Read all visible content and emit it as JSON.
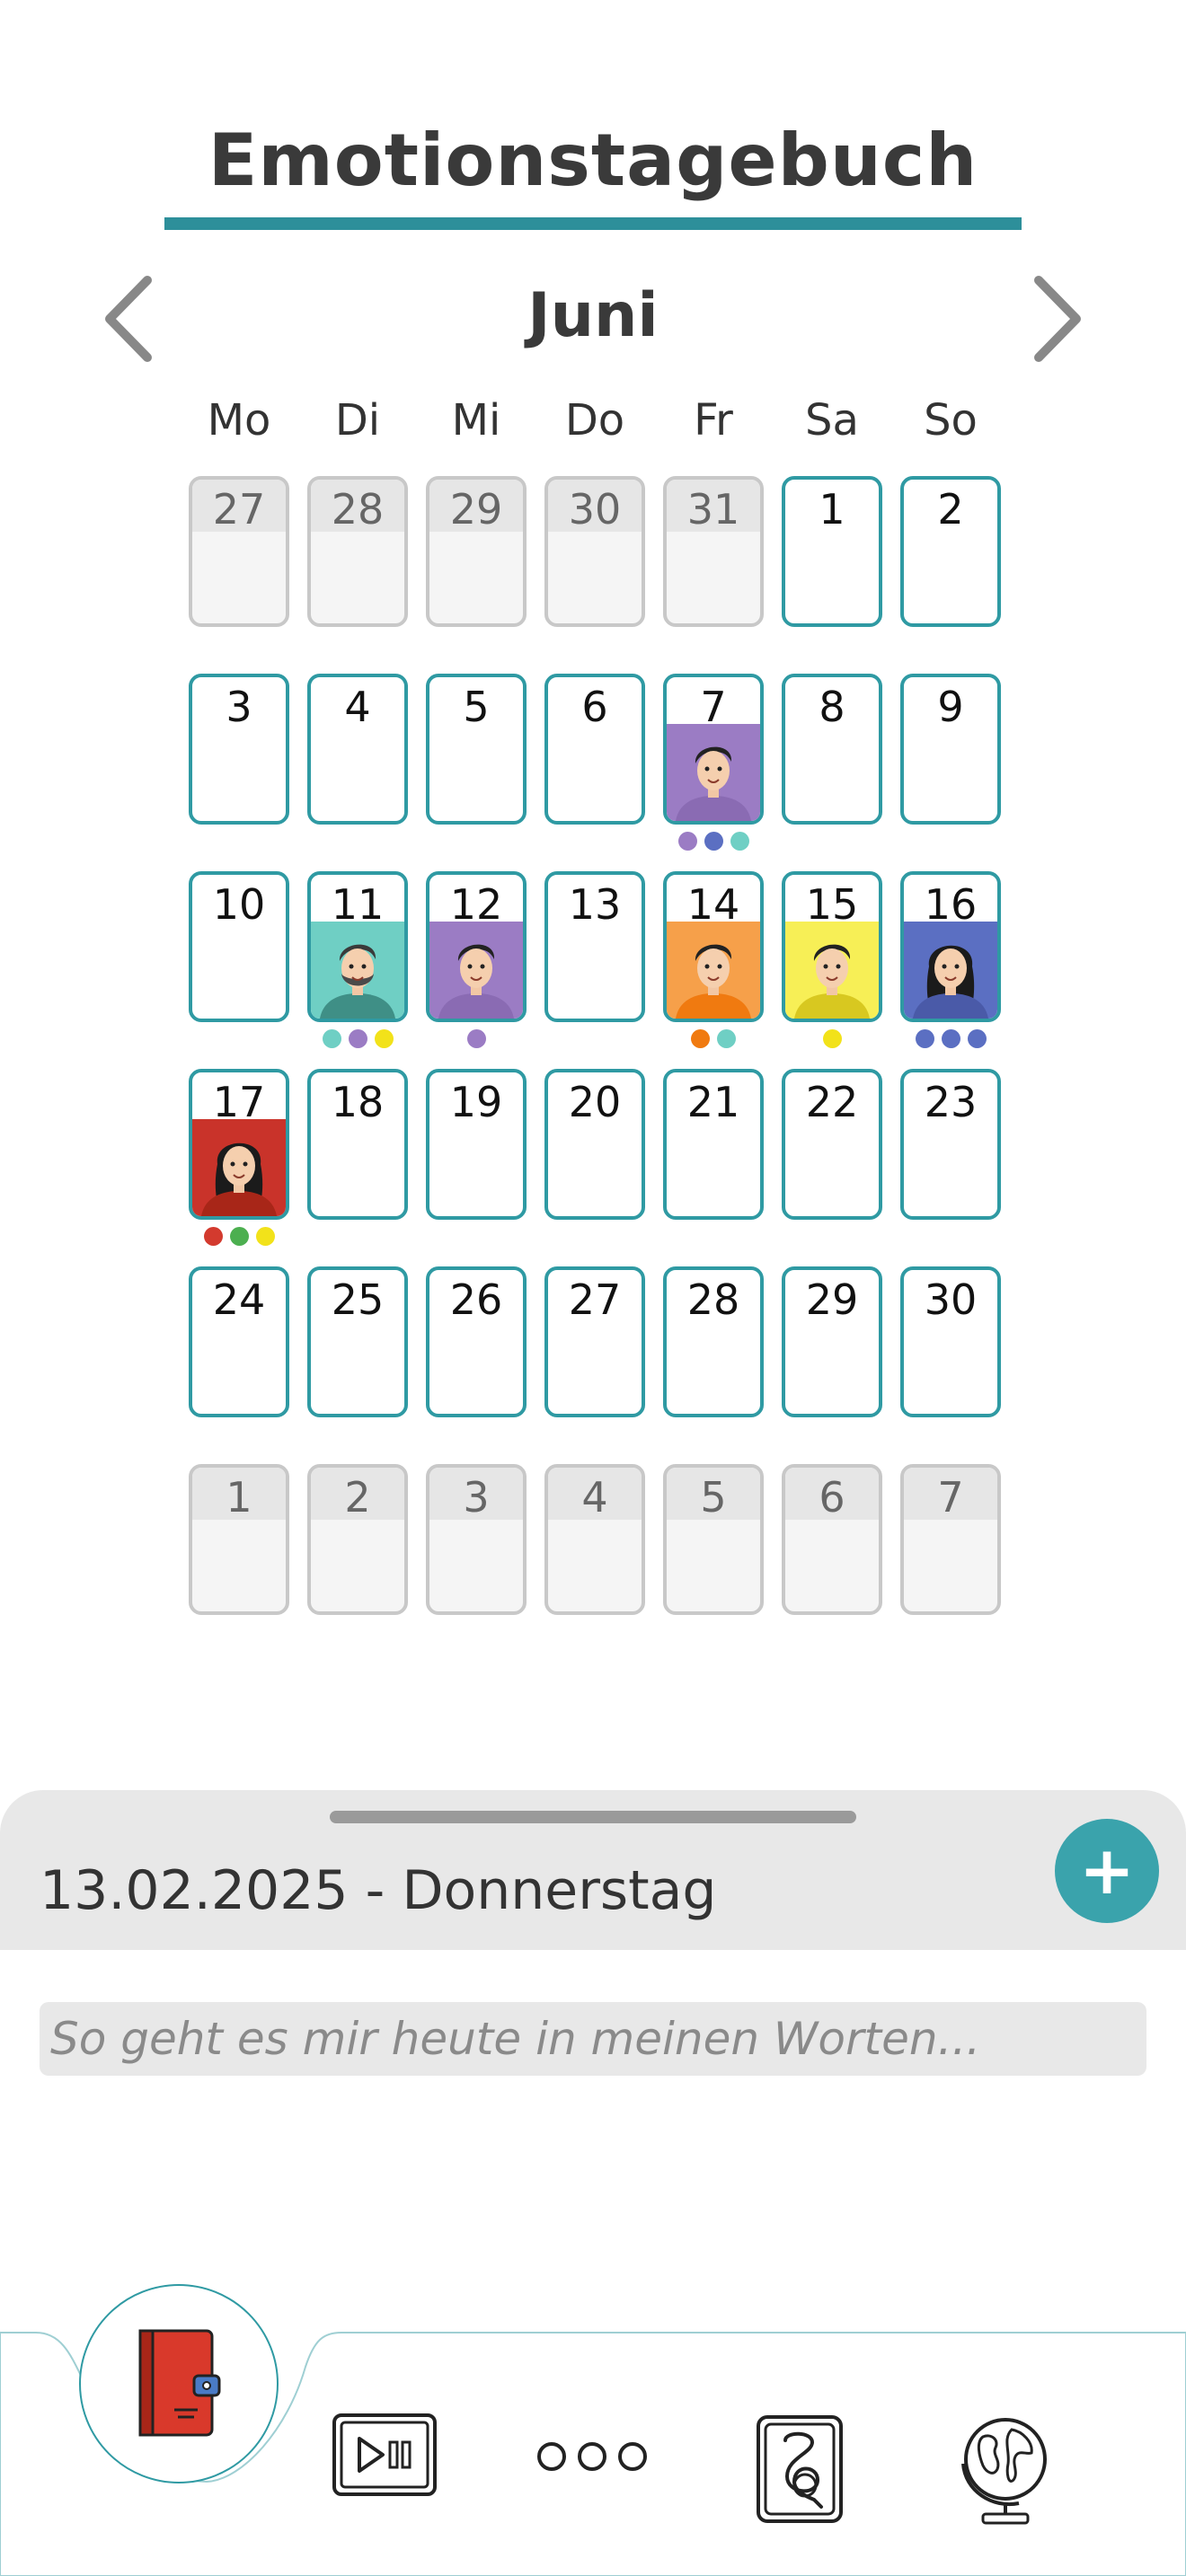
{
  "title": "Emotionstagebuch",
  "month": "Juni",
  "weekdays": [
    "Mo",
    "Di",
    "Mi",
    "Do",
    "Fr",
    "Sa",
    "So"
  ],
  "days": [
    {
      "n": "27",
      "other": true
    },
    {
      "n": "28",
      "other": true
    },
    {
      "n": "29",
      "other": true
    },
    {
      "n": "30",
      "other": true
    },
    {
      "n": "31",
      "other": true
    },
    {
      "n": "1"
    },
    {
      "n": "2"
    },
    {
      "n": "3"
    },
    {
      "n": "4"
    },
    {
      "n": "5"
    },
    {
      "n": "6"
    },
    {
      "n": "7",
      "avatar": "man-purple",
      "dots": [
        "#9b7cc4",
        "#5b6fc2",
        "#6fcfc4"
      ]
    },
    {
      "n": "8"
    },
    {
      "n": "9"
    },
    {
      "n": "10"
    },
    {
      "n": "11",
      "avatar": "man-beard-teal",
      "dots": [
        "#6fcfc4",
        "#9b7cc4",
        "#f2e21a"
      ]
    },
    {
      "n": "12",
      "avatar": "man-purple-2",
      "dots": [
        "#9b7cc4"
      ]
    },
    {
      "n": "13"
    },
    {
      "n": "14",
      "avatar": "man-orange",
      "dots": [
        "#f07a10",
        "#6fcfc4"
      ]
    },
    {
      "n": "15",
      "avatar": "man-yellow",
      "dots": [
        "#f2e21a"
      ]
    },
    {
      "n": "16",
      "avatar": "woman-blue",
      "dots": [
        "#5b6fc2",
        "#5b6fc2",
        "#5b6fc2"
      ]
    },
    {
      "n": "17",
      "avatar": "woman-red",
      "dots": [
        "#d33a2e",
        "#4caf50",
        "#f2e21a"
      ]
    },
    {
      "n": "18"
    },
    {
      "n": "19"
    },
    {
      "n": "20"
    },
    {
      "n": "21"
    },
    {
      "n": "22"
    },
    {
      "n": "23"
    },
    {
      "n": "24"
    },
    {
      "n": "25"
    },
    {
      "n": "26"
    },
    {
      "n": "27"
    },
    {
      "n": "28"
    },
    {
      "n": "29"
    },
    {
      "n": "30"
    },
    {
      "n": "1",
      "other": true
    },
    {
      "n": "2",
      "other": true
    },
    {
      "n": "3",
      "other": true
    },
    {
      "n": "4",
      "other": true
    },
    {
      "n": "5",
      "other": true
    },
    {
      "n": "6",
      "other": true
    },
    {
      "n": "7",
      "other": true
    }
  ],
  "sheet": {
    "date_label": "13.02.2025 - Donnerstag",
    "add_label": "+",
    "note_placeholder": "So geht es mir heute in meinen Worten..."
  },
  "nav": {
    "items": [
      "diary-icon",
      "media-icon",
      "more-icon",
      "card-icon",
      "globe-icon"
    ]
  },
  "colors": {
    "accent": "#2f9aa3",
    "purple": "#9b7cc4",
    "teal": "#6fcfc4",
    "orange": "#f07a10",
    "yellow": "#f2e21a",
    "blue": "#5b6fc2",
    "red": "#d33a2e",
    "green": "#4caf50"
  }
}
